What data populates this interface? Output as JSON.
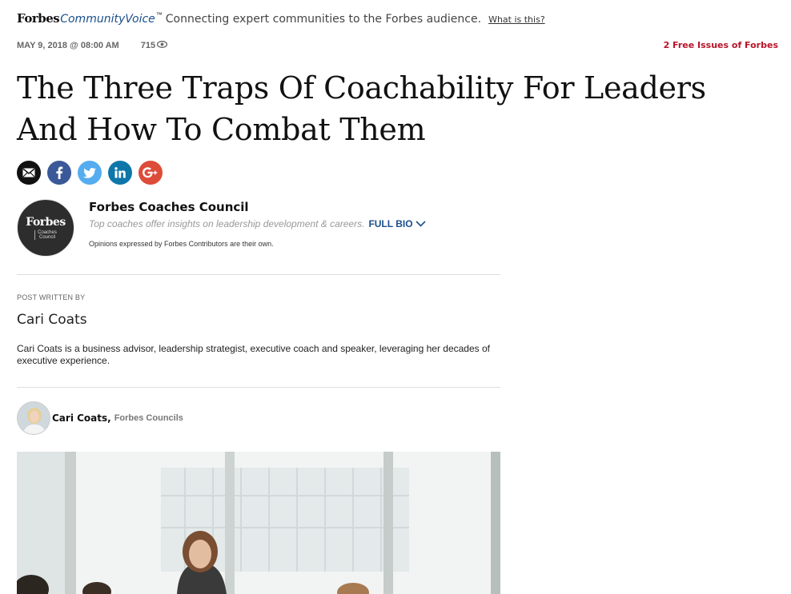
{
  "topbar": {
    "brand": "Forbes",
    "brand_sub": "CommunityVoice",
    "trademark": "™",
    "tagline": "Connecting expert communities to the Forbes audience.",
    "what_is_this": "What is this?"
  },
  "meta": {
    "date": "MAY 9, 2018 @ 08:00 AM",
    "views": "715"
  },
  "free_issues": "2 Free Issues of Forbes",
  "headline": "The Three Traps Of Coachability For Leaders And How To Combat Them",
  "share": [
    {
      "name": "email-icon",
      "color": "#111111"
    },
    {
      "name": "facebook-icon",
      "color": "#3b5998"
    },
    {
      "name": "twitter-icon",
      "color": "#55acee"
    },
    {
      "name": "linkedin-icon",
      "color": "#0e76a8"
    },
    {
      "name": "google-plus-icon",
      "color": "#dd4b39"
    }
  ],
  "council": {
    "avatar_brand": "Forbes",
    "avatar_sub_line1": "Coaches",
    "avatar_sub_line2": "Council",
    "name": "Forbes Coaches Council",
    "description": "Top coaches offer insights on leadership development & careers.",
    "full_bio": "FULL BIO",
    "disclaimer": "Opinions expressed by Forbes Contributors are their own."
  },
  "post_written_by": {
    "label": "POST WRITTEN BY",
    "name": "Cari Coats",
    "bio": "Cari Coats is a business advisor, leadership strategist, executive coach and speaker, leveraging her decades of executive experience."
  },
  "byline": {
    "name": "Cari Coats,",
    "org": "Forbes Councils"
  },
  "colors": {
    "accent_blue": "#1a4f8b",
    "accent_red": "#b8142a"
  }
}
